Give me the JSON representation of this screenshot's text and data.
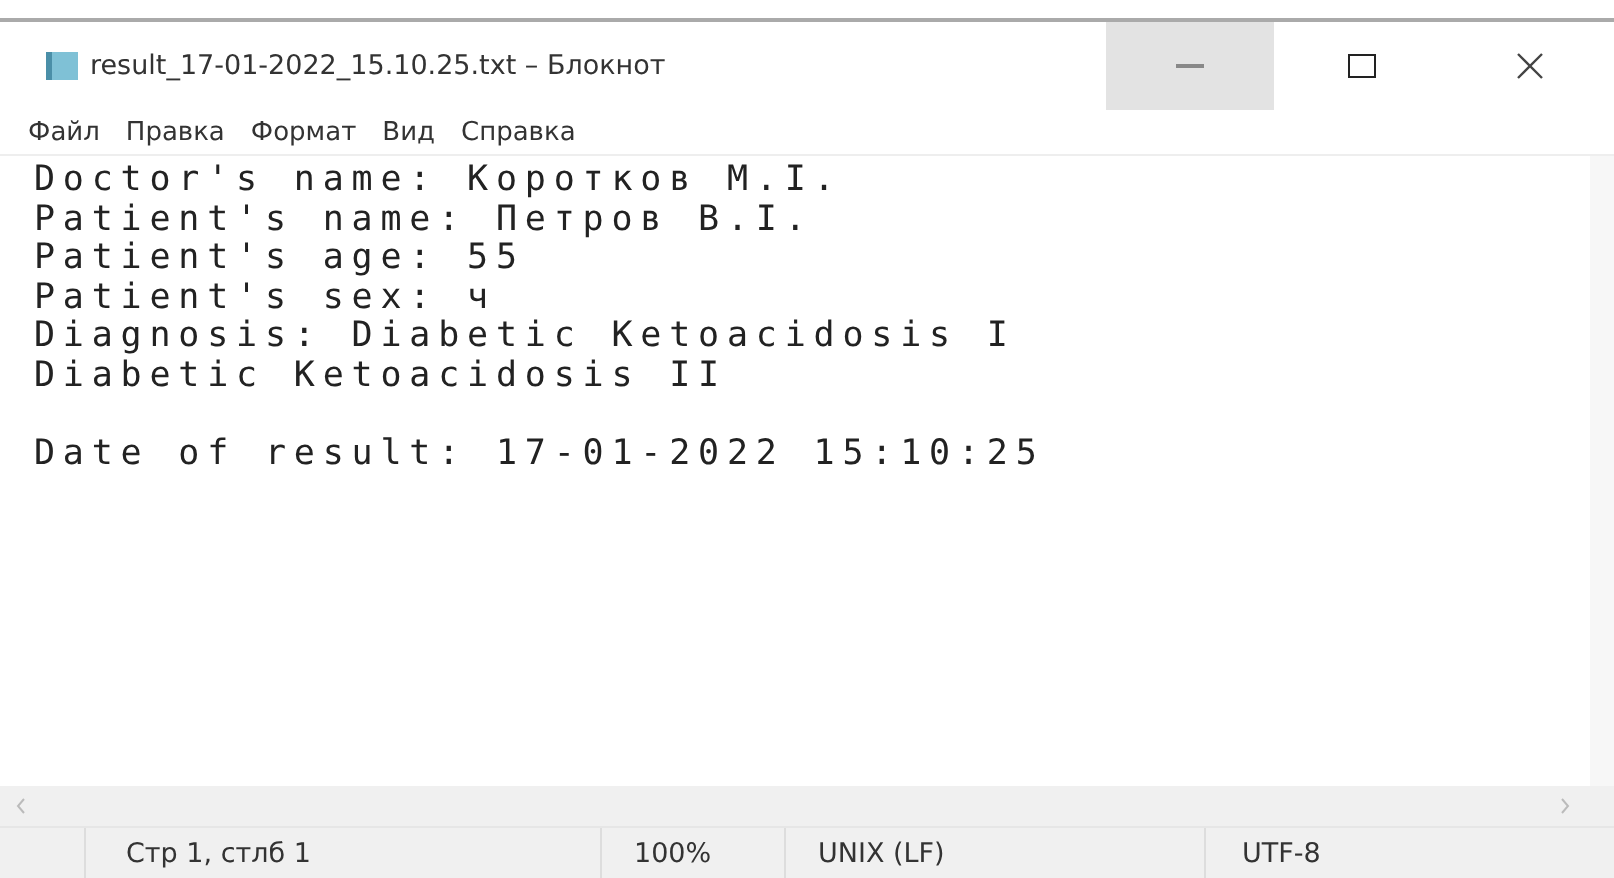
{
  "window": {
    "title": "result_17-01-2022_15.10.25.txt – Блокнот"
  },
  "menu": [
    "Файл",
    "Правка",
    "Формат",
    "Вид",
    "Справка"
  ],
  "document": {
    "paragraphs": [
      [
        "Doctor's name: Коротков М.I.",
        "Patient's name: Петров В.I.",
        "Patient's age: 55",
        "Patient's sex: ч",
        "Diagnosis: Diabetic Ketoacidosis I",
        "Diabetic Ketoacidosis II"
      ],
      [
        "Date of result: 17-01-2022 15:10:25"
      ]
    ]
  },
  "status_bar": [
    "Стр 1, стлб 1",
    "100%",
    "UNIX (LF)",
    "UTF-8"
  ]
}
